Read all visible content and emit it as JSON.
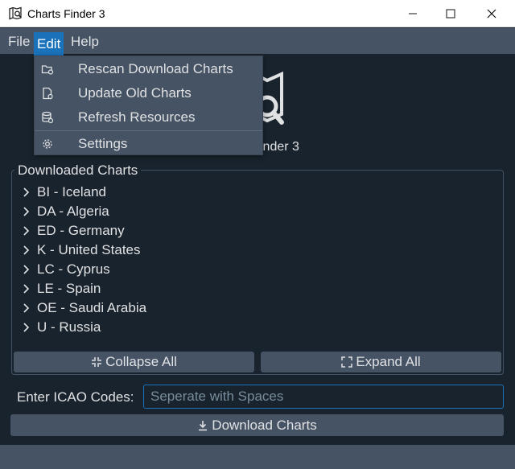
{
  "window": {
    "title": "Charts Finder 3"
  },
  "menubar": {
    "file": "File",
    "edit": "Edit",
    "help": "Help"
  },
  "edit_menu": {
    "items": [
      {
        "label": "Rescan Download Charts",
        "icon": "folder-refresh-icon"
      },
      {
        "label": "Update Old Charts",
        "icon": "file-refresh-icon"
      },
      {
        "label": "Refresh Resources",
        "icon": "database-refresh-icon"
      },
      {
        "label": "Settings",
        "icon": "gear-icon"
      }
    ]
  },
  "app_name_visible": "inder 3",
  "downloaded": {
    "title": "Downloaded Charts",
    "items": [
      "BI - Iceland",
      "DA - Algeria",
      "ED - Germany",
      "K - United States",
      "LC - Cyprus",
      "LE - Spain",
      "OE - Saudi Arabia",
      "U - Russia"
    ],
    "collapse_label": "Collapse All",
    "expand_label": "Expand All"
  },
  "icao": {
    "label": "Enter ICAO Codes:",
    "value": "",
    "placeholder": "Seperate with Spaces"
  },
  "download_label": "Download Charts",
  "colors": {
    "background": "#19232d",
    "panel": "#455364",
    "accent": "#1a72bb",
    "text": "#e0e1e3"
  }
}
